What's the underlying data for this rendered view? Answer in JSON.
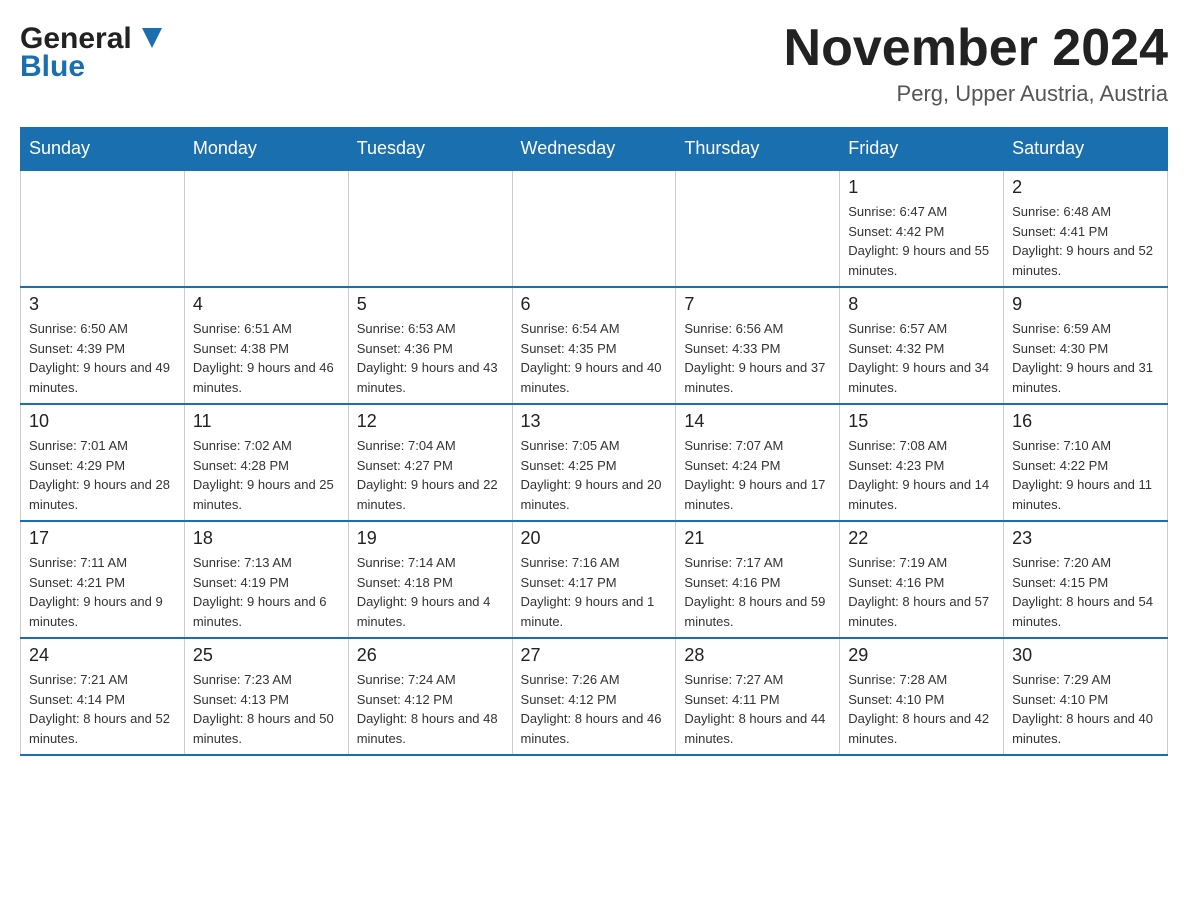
{
  "header": {
    "logo_general": "General",
    "logo_blue": "Blue",
    "month_title": "November 2024",
    "location": "Perg, Upper Austria, Austria"
  },
  "days_of_week": [
    "Sunday",
    "Monday",
    "Tuesday",
    "Wednesday",
    "Thursday",
    "Friday",
    "Saturday"
  ],
  "weeks": [
    [
      {
        "day": "",
        "info": ""
      },
      {
        "day": "",
        "info": ""
      },
      {
        "day": "",
        "info": ""
      },
      {
        "day": "",
        "info": ""
      },
      {
        "day": "",
        "info": ""
      },
      {
        "day": "1",
        "info": "Sunrise: 6:47 AM\nSunset: 4:42 PM\nDaylight: 9 hours and 55 minutes."
      },
      {
        "day": "2",
        "info": "Sunrise: 6:48 AM\nSunset: 4:41 PM\nDaylight: 9 hours and 52 minutes."
      }
    ],
    [
      {
        "day": "3",
        "info": "Sunrise: 6:50 AM\nSunset: 4:39 PM\nDaylight: 9 hours and 49 minutes."
      },
      {
        "day": "4",
        "info": "Sunrise: 6:51 AM\nSunset: 4:38 PM\nDaylight: 9 hours and 46 minutes."
      },
      {
        "day": "5",
        "info": "Sunrise: 6:53 AM\nSunset: 4:36 PM\nDaylight: 9 hours and 43 minutes."
      },
      {
        "day": "6",
        "info": "Sunrise: 6:54 AM\nSunset: 4:35 PM\nDaylight: 9 hours and 40 minutes."
      },
      {
        "day": "7",
        "info": "Sunrise: 6:56 AM\nSunset: 4:33 PM\nDaylight: 9 hours and 37 minutes."
      },
      {
        "day": "8",
        "info": "Sunrise: 6:57 AM\nSunset: 4:32 PM\nDaylight: 9 hours and 34 minutes."
      },
      {
        "day": "9",
        "info": "Sunrise: 6:59 AM\nSunset: 4:30 PM\nDaylight: 9 hours and 31 minutes."
      }
    ],
    [
      {
        "day": "10",
        "info": "Sunrise: 7:01 AM\nSunset: 4:29 PM\nDaylight: 9 hours and 28 minutes."
      },
      {
        "day": "11",
        "info": "Sunrise: 7:02 AM\nSunset: 4:28 PM\nDaylight: 9 hours and 25 minutes."
      },
      {
        "day": "12",
        "info": "Sunrise: 7:04 AM\nSunset: 4:27 PM\nDaylight: 9 hours and 22 minutes."
      },
      {
        "day": "13",
        "info": "Sunrise: 7:05 AM\nSunset: 4:25 PM\nDaylight: 9 hours and 20 minutes."
      },
      {
        "day": "14",
        "info": "Sunrise: 7:07 AM\nSunset: 4:24 PM\nDaylight: 9 hours and 17 minutes."
      },
      {
        "day": "15",
        "info": "Sunrise: 7:08 AM\nSunset: 4:23 PM\nDaylight: 9 hours and 14 minutes."
      },
      {
        "day": "16",
        "info": "Sunrise: 7:10 AM\nSunset: 4:22 PM\nDaylight: 9 hours and 11 minutes."
      }
    ],
    [
      {
        "day": "17",
        "info": "Sunrise: 7:11 AM\nSunset: 4:21 PM\nDaylight: 9 hours and 9 minutes."
      },
      {
        "day": "18",
        "info": "Sunrise: 7:13 AM\nSunset: 4:19 PM\nDaylight: 9 hours and 6 minutes."
      },
      {
        "day": "19",
        "info": "Sunrise: 7:14 AM\nSunset: 4:18 PM\nDaylight: 9 hours and 4 minutes."
      },
      {
        "day": "20",
        "info": "Sunrise: 7:16 AM\nSunset: 4:17 PM\nDaylight: 9 hours and 1 minute."
      },
      {
        "day": "21",
        "info": "Sunrise: 7:17 AM\nSunset: 4:16 PM\nDaylight: 8 hours and 59 minutes."
      },
      {
        "day": "22",
        "info": "Sunrise: 7:19 AM\nSunset: 4:16 PM\nDaylight: 8 hours and 57 minutes."
      },
      {
        "day": "23",
        "info": "Sunrise: 7:20 AM\nSunset: 4:15 PM\nDaylight: 8 hours and 54 minutes."
      }
    ],
    [
      {
        "day": "24",
        "info": "Sunrise: 7:21 AM\nSunset: 4:14 PM\nDaylight: 8 hours and 52 minutes."
      },
      {
        "day": "25",
        "info": "Sunrise: 7:23 AM\nSunset: 4:13 PM\nDaylight: 8 hours and 50 minutes."
      },
      {
        "day": "26",
        "info": "Sunrise: 7:24 AM\nSunset: 4:12 PM\nDaylight: 8 hours and 48 minutes."
      },
      {
        "day": "27",
        "info": "Sunrise: 7:26 AM\nSunset: 4:12 PM\nDaylight: 8 hours and 46 minutes."
      },
      {
        "day": "28",
        "info": "Sunrise: 7:27 AM\nSunset: 4:11 PM\nDaylight: 8 hours and 44 minutes."
      },
      {
        "day": "29",
        "info": "Sunrise: 7:28 AM\nSunset: 4:10 PM\nDaylight: 8 hours and 42 minutes."
      },
      {
        "day": "30",
        "info": "Sunrise: 7:29 AM\nSunset: 4:10 PM\nDaylight: 8 hours and 40 minutes."
      }
    ]
  ]
}
